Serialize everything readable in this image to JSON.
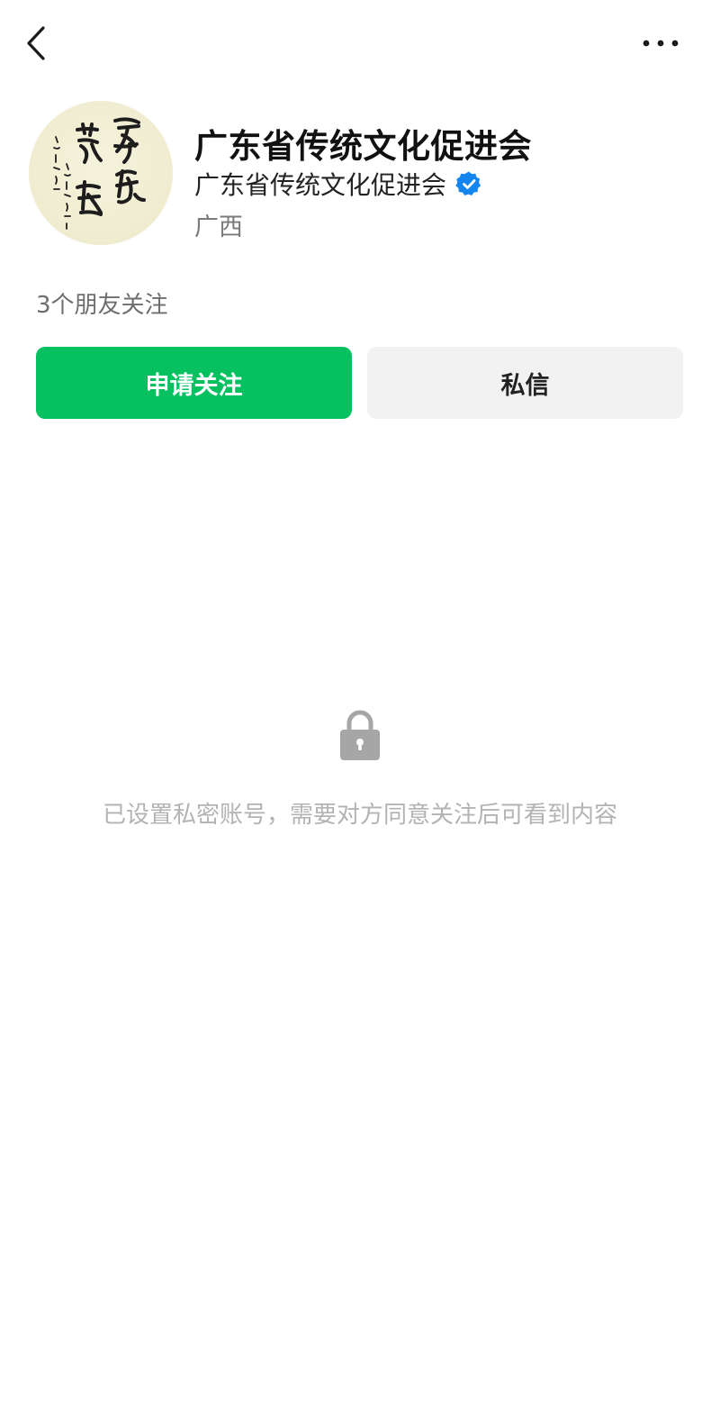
{
  "topbar": {
    "back_icon": "chevron-left-icon",
    "more_icon": "more-horizontal-icon"
  },
  "profile": {
    "avatar_description": "calligraphy",
    "nickname": "广东省传统文化促进会",
    "account_name": "广东省传统文化促进会",
    "verified_icon": "verified-badge-icon",
    "verified_color": "#1485ee",
    "region": "广西"
  },
  "social": {
    "friends_follow": "3个朋友关注"
  },
  "actions": {
    "follow_label": "申请关注",
    "follow_color": "#07c160",
    "message_label": "私信"
  },
  "privacy": {
    "lock_icon": "lock-icon",
    "notice": "已设置私密账号，需要对方同意关注后可看到内容"
  }
}
